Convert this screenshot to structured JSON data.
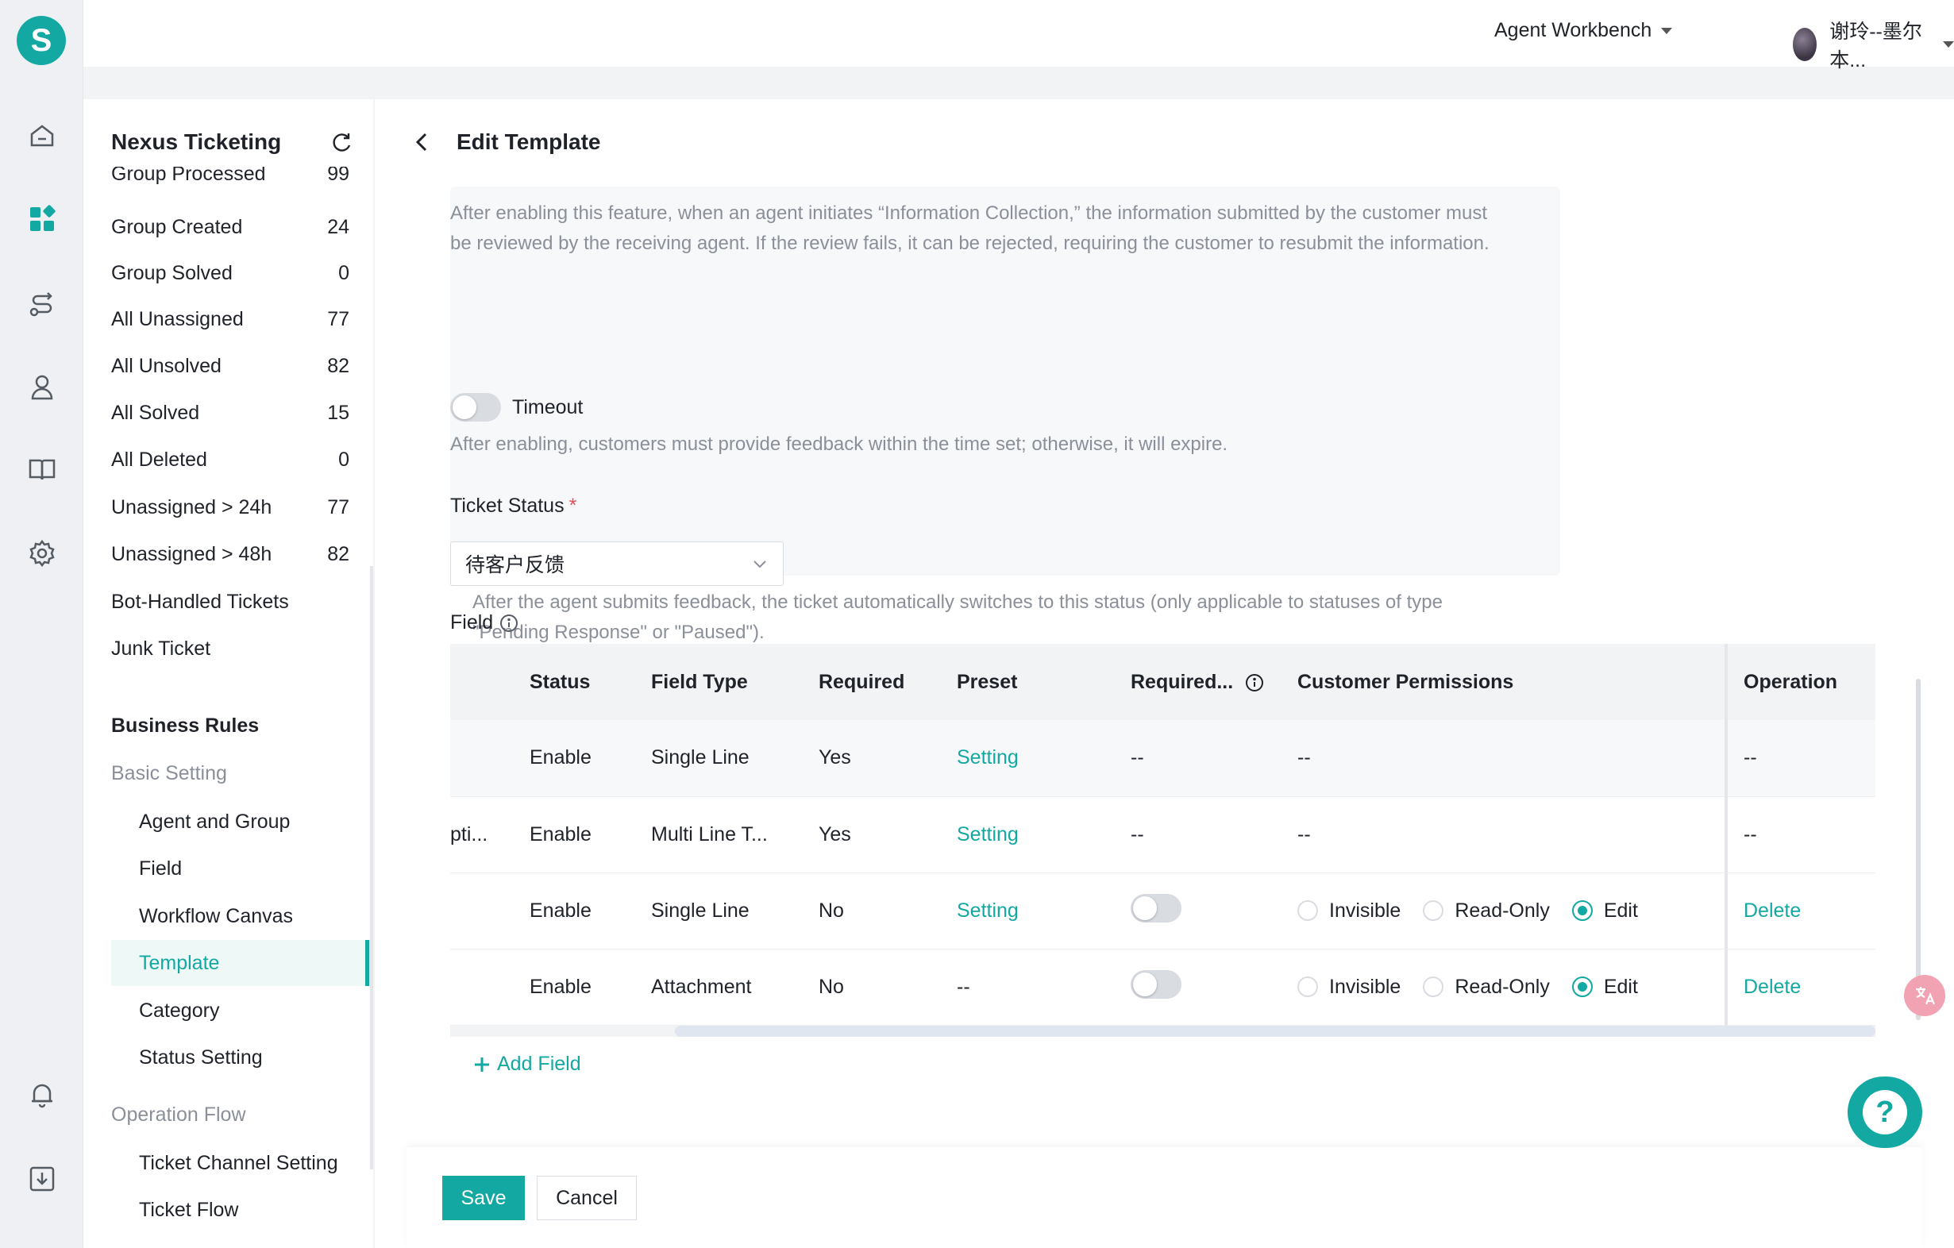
{
  "app": {
    "logo_letter": "S",
    "brand_color": "#14a8a2"
  },
  "rail": {
    "icons": [
      "home-icon",
      "dashboard-icon",
      "route-icon",
      "user-icon",
      "book-icon",
      "settings-icon",
      "bell-icon",
      "download-icon"
    ]
  },
  "topbar": {
    "workbench_label": "Agent Workbench",
    "user_name": "谢玲--墨尔本..."
  },
  "sidebar": {
    "title": "Nexus Ticketing",
    "partial_item_label": "Group Processed",
    "partial_item_count": "99",
    "items": [
      {
        "label": "Group Created",
        "count": "24"
      },
      {
        "label": "Group Solved",
        "count": "0"
      },
      {
        "label": "All Unassigned",
        "count": "77"
      },
      {
        "label": "All Unsolved",
        "count": "82"
      },
      {
        "label": "All Solved",
        "count": "15"
      },
      {
        "label": "All Deleted",
        "count": "0"
      },
      {
        "label": "Unassigned > 24h",
        "count": "77"
      },
      {
        "label": "Unassigned > 48h",
        "count": "82"
      },
      {
        "label": "Bot-Handled Tickets",
        "count": ""
      },
      {
        "label": "Junk Ticket",
        "count": ""
      }
    ],
    "business_rules_label": "Business Rules",
    "basic_setting_label": "Basic Setting",
    "basic_setting_items": [
      "Agent and Group",
      "Field",
      "Workflow Canvas",
      "Template",
      "Category",
      "Status Setting"
    ],
    "active_item": "Template",
    "operation_flow_label": "Operation Flow",
    "operation_flow_items": [
      "Ticket Channel Setting",
      "Ticket Flow"
    ]
  },
  "page": {
    "title": "Edit Template",
    "review_desc": "After enabling this feature, when an agent initiates “Information Collection,” the information submitted by the customer must be reviewed by the receiving agent. If the review fails, it can be rejected, requiring the customer to resubmit the information.",
    "timeout_label": "Timeout",
    "timeout_desc": "After enabling, customers must provide feedback within the time set; otherwise, it will expire.",
    "ticket_status_label": "Ticket Status",
    "ticket_status_required": "*",
    "ticket_status_value": "待客户反馈",
    "ticket_status_desc": "After the agent submits feedback, the ticket automatically switches to this status (only applicable to statuses of type \"Pending Response\" or \"Paused\").",
    "field_label": "Field"
  },
  "table": {
    "columns": [
      "",
      "Status",
      "Field Type",
      "Required",
      "Preset",
      "Required...",
      "Customer Permissions",
      "Operation"
    ],
    "rows": [
      {
        "name": "",
        "status": "Enable",
        "type": "Single Line",
        "required": "Yes",
        "preset": "Setting",
        "req2": "--",
        "perm": "--",
        "op": "--",
        "perm_mode": "text"
      },
      {
        "name": "pti...",
        "status": "Enable",
        "type": "Multi Line T...",
        "required": "Yes",
        "preset": "Setting",
        "req2": "--",
        "perm": "--",
        "op": "--",
        "perm_mode": "text"
      },
      {
        "name": "",
        "status": "Enable",
        "type": "Single Line",
        "required": "No",
        "preset": "Setting",
        "req2": "toggle",
        "perm": "Edit",
        "op": "Delete",
        "perm_mode": "radio"
      },
      {
        "name": "",
        "status": "Enable",
        "type": "Attachment",
        "required": "No",
        "preset": "--",
        "req2": "toggle",
        "perm": "Edit",
        "op": "Delete",
        "perm_mode": "radio"
      }
    ],
    "perm_options": [
      "Invisible",
      "Read-Only",
      "Edit"
    ]
  },
  "actions": {
    "add_field": "Add Field",
    "save": "Save",
    "cancel": "Cancel"
  }
}
